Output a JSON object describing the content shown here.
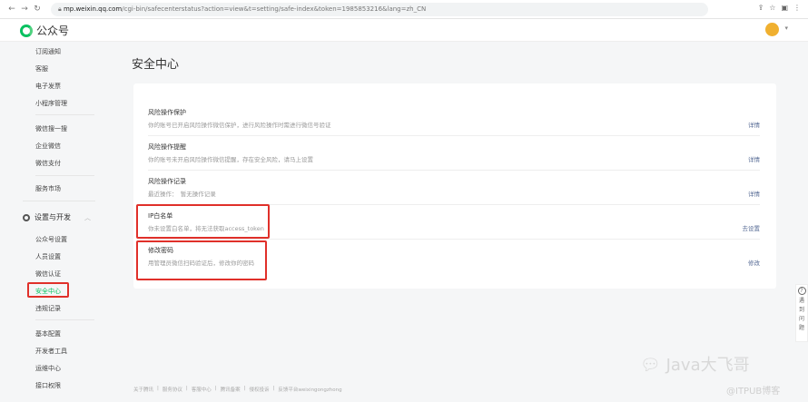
{
  "browser": {
    "url_host": "mp.weixin.qq.com",
    "url_path": "/cgi-bin/safecenterstatus?action=view&t=setting/safe-index&token=1985853216&lang=zh_CN"
  },
  "header": {
    "logo": "公众号"
  },
  "sidebar": {
    "items_top": [
      "订阅通知",
      "客服",
      "电子发票",
      "小程序管理"
    ],
    "items_mid": [
      "微信搜一搜",
      "企业微信",
      "微信支付"
    ],
    "items_mkt": [
      "服务市场"
    ],
    "group": "设置与开发",
    "items_settings": [
      "公众号设置",
      "人员设置",
      "微信认证",
      "安全中心",
      "违规记录"
    ],
    "items_dev": [
      "基本配置",
      "开发者工具",
      "运维中心",
      "接口权限"
    ]
  },
  "main": {
    "title": "安全中心",
    "rows": [
      {
        "title": "风险操作保护",
        "desc": "你的账号已开启风险操作微信保护，进行风险操作时需进行微信号验证",
        "action": "详情"
      },
      {
        "title": "风险操作提醒",
        "desc": "你的账号未开启风险操作微信提醒，存在安全风险，请马上设置",
        "action": "详情"
      },
      {
        "title": "风险操作记录",
        "desc": "最近操作：　暂无操作记录",
        "action": "详情"
      },
      {
        "title": "IP白名单",
        "desc": "你未设置白名单，将无法获取access_token",
        "action": "去设置"
      },
      {
        "title": "修改密码",
        "desc": "用管理员微信扫码验证后，修改你的密码",
        "action": "修改"
      }
    ]
  },
  "footer": [
    "关于腾讯",
    "|",
    "服务协议",
    "|",
    "客服中心",
    "|",
    "腾讯备案",
    "|",
    "侵权投诉",
    "|",
    "反馈平台weixingongzhong"
  ],
  "help": {
    "icon": "?",
    "label": [
      "遇",
      "到",
      "问",
      "题"
    ]
  },
  "watermark": {
    "line1": "Java大飞哥",
    "line2": "@ITPUB博客"
  }
}
